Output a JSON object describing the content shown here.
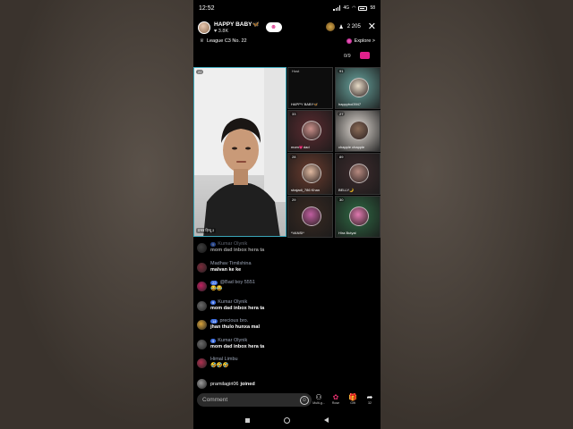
{
  "status_bar": {
    "time": "12:52",
    "network": "4G",
    "battery": "58"
  },
  "header": {
    "host_name": "HAPPY BABY🦋",
    "host_likes": "3.8K",
    "viewer_count": "2 205",
    "league": "League C3 No. 22",
    "explore_label": "Explore >",
    "seat_counter": "0/9"
  },
  "main_video": {
    "badge": "22",
    "label": "प्रभव हिन्दू ३"
  },
  "tiles": [
    {
      "seat": "",
      "name": "HAPPY BABY🦋",
      "top_label": "Host",
      "color": "#0d0d0d",
      "face": "#0d0d0d"
    },
    {
      "seat": "91",
      "name": "happyboi3947",
      "color": "#6aa6a0",
      "face": "#e8dcc8"
    },
    {
      "seat": "33",
      "name": "mom💗dad",
      "color": "#5c2b30",
      "face": "#c98f8a"
    },
    {
      "seat": "27",
      "name": "chapple chapple",
      "color": "#e4ddd6",
      "face": "#8a6b57"
    },
    {
      "seat": "28",
      "name": "shajadi_786 Khan",
      "color": "#6b3c2e",
      "face": "#e0b9a0"
    },
    {
      "seat": "89",
      "name": "BELLY🌙",
      "color": "#3e2b2d",
      "face": "#b78a80"
    },
    {
      "seat": "29",
      "name": "*VANSI*",
      "color": "#3a2a22",
      "face": "#c05ea0"
    },
    {
      "seat": "30",
      "name": "Hira Butyal",
      "color": "#2f6a44",
      "face": "#e07ab0"
    }
  ],
  "chat": [
    {
      "user": "Kumar Olynik",
      "level": "9",
      "text": "mom dad inbox hera ta",
      "avatar": "#6a6a6a"
    },
    {
      "user": "Madhav Timilshina",
      "level": "",
      "text": "malvan ke ke",
      "avatar": "#7a2a3a"
    },
    {
      "user": "@Bad boy 5551",
      "level": "22",
      "text": "😂😂",
      "avatar": "#c02060"
    },
    {
      "user": "Kumar Olynik",
      "level": "9",
      "text": "mom dad inbox hera ta",
      "avatar": "#6a6a6a"
    },
    {
      "user": "precious bro.",
      "level": "14",
      "text": "jhan thulo hunxa mal",
      "avatar": "#d9a33a"
    },
    {
      "user": "Kumar Olynik",
      "level": "9",
      "text": "mom dad inbox hera ta",
      "avatar": "#6a6a6a"
    },
    {
      "user": "Himal Limbu",
      "level": "",
      "text": "🤣🤣🤣",
      "avatar": "#b03050"
    },
    {
      "user": "pramilagiri06",
      "level": "",
      "text": "joined",
      "avatar": "#9a9a9a"
    }
  ],
  "bottom": {
    "comment_placeholder": "Comment",
    "actions": [
      {
        "icon": "multi-guest-icon",
        "label": "Multi-g..."
      },
      {
        "icon": "rose-icon",
        "label": "Rose"
      },
      {
        "icon": "gift-icon",
        "label": "Gift"
      },
      {
        "icon": "share-icon",
        "label": "32"
      }
    ]
  },
  "colors": {
    "accent": "#e0509c",
    "tile_border": "#3aa6b9",
    "username": "#9aa3b5"
  }
}
